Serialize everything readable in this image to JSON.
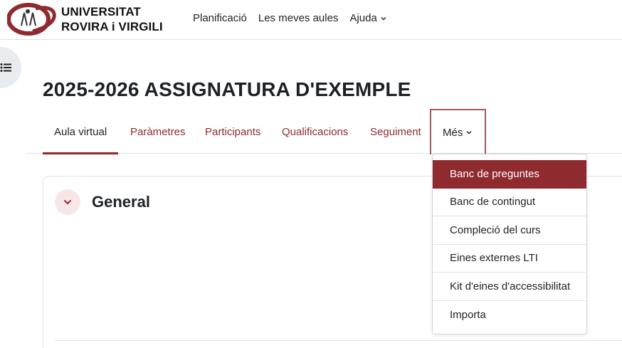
{
  "brand": {
    "line1": "UNIVERSITAT",
    "line2": "ROVIRA i VIRGILI",
    "logo_icon": "urv-seal-icon"
  },
  "topnav": {
    "items": [
      {
        "label": "Planificació"
      },
      {
        "label": "Les meves aules"
      },
      {
        "label": "Ajuda",
        "has_dropdown": true
      }
    ]
  },
  "drawer_toggle_icon": "list-icon",
  "page_title": "2025-2026 ASSIGNATURA D'EXEMPLE",
  "secondary_nav": {
    "tabs": [
      {
        "label": "Aula virtual",
        "active": true
      },
      {
        "label": "Paràmetres"
      },
      {
        "label": "Participants"
      },
      {
        "label": "Qualificacions"
      },
      {
        "label": "Seguiment"
      },
      {
        "label": "Més",
        "has_dropdown": true,
        "open": true
      }
    ]
  },
  "more_menu": {
    "items": [
      {
        "label": "Banc de preguntes",
        "selected": true
      },
      {
        "label": "Banc de contingut"
      },
      {
        "label": "Compleció del curs"
      },
      {
        "label": "Eines externes LTI"
      },
      {
        "label": "Kit d'eines d'accessibilitat"
      },
      {
        "label": "Importa"
      }
    ]
  },
  "section": {
    "title": "General",
    "toggle_icon": "chevron-down-icon"
  },
  "colors": {
    "accent": "#8f2a2e",
    "accent_light": "#f6e6e7",
    "border": "#dee2e6",
    "text": "#1d2125"
  }
}
